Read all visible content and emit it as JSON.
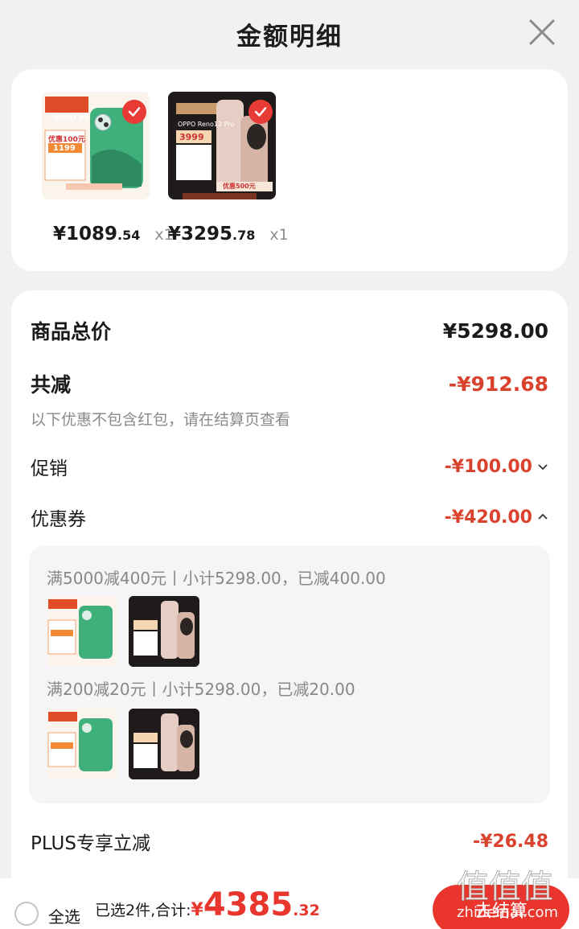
{
  "header": {
    "title": "金额明细"
  },
  "products": [
    {
      "price_main": "¥1089",
      "price_dec": ".54",
      "qty": "x1",
      "badge_title": "OPPO A3",
      "badge_promo": "优惠100元",
      "badge_price": "1199"
    },
    {
      "price_main": "¥3295",
      "price_dec": ".78",
      "qty": "x1",
      "badge_title": "OPPO Reno12 Pro",
      "badge_promo": "优惠500元",
      "badge_price": "3999"
    }
  ],
  "summary": {
    "goods_total_label": "商品总价",
    "goods_total_value": "¥5298.00",
    "total_reduce_label": "共减",
    "total_reduce_value": "-¥912.68",
    "note": "以下优惠不包含红包，请在结算页查看",
    "promo_label": "促销",
    "promo_value": "-¥100.00",
    "coupon_label": "优惠券",
    "coupon_value": "-¥420.00",
    "plus_label": "PLUS专享立减",
    "plus_value": "-¥26.48"
  },
  "coupons": [
    {
      "text": "满5000减400元丨小计5298.00，已减400.00"
    },
    {
      "text": "满200减20元丨小计5298.00，已减20.00"
    }
  ],
  "bottom": {
    "select_all": "全选",
    "total_label": "已选2件,合计:",
    "yen": "¥",
    "total_int": "4385",
    "total_dec": ".32",
    "checkout": "去结算"
  },
  "watermark": {
    "text": "值值值",
    "site": "zhidemai.com"
  },
  "colors": {
    "accent_red": "#e9352c",
    "price_red": "#d9432d"
  }
}
